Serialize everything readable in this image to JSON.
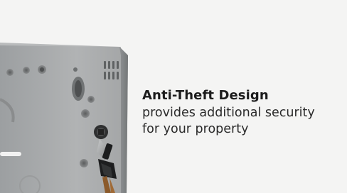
{
  "feature": {
    "title": "Anti-Theft Design",
    "description": "provides additional security for your property"
  },
  "image": {
    "subject": "mounting-plate-with-lock-keys"
  },
  "colors": {
    "background": "#f4f4f3",
    "text": "#1c1c1c"
  }
}
